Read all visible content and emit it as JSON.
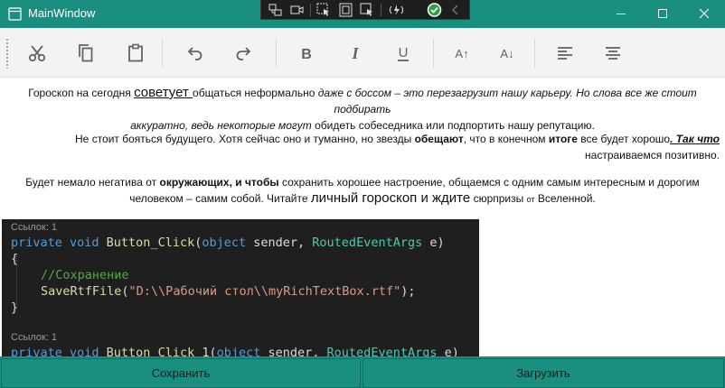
{
  "window": {
    "title": "MainWindow",
    "accent": "#1a8f7f",
    "controls": [
      "minimize-icon",
      "maximize-icon",
      "close-icon"
    ]
  },
  "devtools": {
    "icons": [
      "live-visual-tree-icon",
      "camera-icon",
      "select-element-icon",
      "display-layout-adorners-icon",
      "track-focus-icon",
      "hot-reload-icon",
      "check-icon",
      "collapse-chevron-icon"
    ]
  },
  "toolbar": {
    "icons": [
      "cut-icon",
      "copy-icon",
      "paste-icon",
      "undo-icon",
      "redo-icon",
      "bold-icon",
      "italic-icon",
      "underline-icon",
      "increase-font-icon",
      "decrease-font-icon",
      "align-left-icon",
      "align-center-icon"
    ],
    "bold_glyph": "B",
    "italic_glyph": "I",
    "underline_glyph": "U",
    "inc_glyph": "A↑",
    "dec_glyph": "A↓"
  },
  "document": {
    "p1": {
      "a": "Гороскоп на сегодня ",
      "b": "советует ",
      "c": "общаться неформально ",
      "d": "даже с боссом – это перезагрузит нашу карьеру. Но слова все же стоит подбирать",
      "e": "аккуратно, ведь некоторые могут ",
      "f": "обидеть собеседника или подпортить нашу репутацию."
    },
    "p2": {
      "a": "Не стоит бояться будущего. Хотя сейчас оно и туманно, но звезды ",
      "b": "обещают",
      "c": ", что в конечном ",
      "d": "итоге",
      "e": " все будет хорошо",
      "f": ". Так что",
      "g": "настраиваемся позитивно."
    },
    "p3": {
      "a": "Будет немало негатива от ",
      "b": "окружающих, и чтобы",
      "c": " сохранить хорошее настроение, общаемся с одним самым интересным и дорогим",
      "d": "человеком – самим собой. Читайте ",
      "e": "личный гороскоп и ждите",
      "f": " сюрпризы ",
      "g": "от",
      "h": " Вселенной."
    },
    "code": {
      "ref1": "Ссылок: 1",
      "sig1": {
        "kw": "private void ",
        "name": "Button_Click",
        "p1": "(",
        "kw2": "object",
        "p2": " sender, ",
        "type": "RoutedEventArgs",
        "p3": " e)"
      },
      "open": "{",
      "comment": "//Сохранение",
      "call": {
        "name": "SaveRtfFile",
        "p1": "(",
        "str": "\"D:\\\\Рабочий стол\\\\myRichTextBox.rtf\"",
        "p2": ");"
      },
      "close": "}",
      "ref2": "Ссылок: 1",
      "sig2": {
        "kw": "private void ",
        "name": "Button_Click_1",
        "p1": "(",
        "kw2": "object",
        "p2": " sender, ",
        "type": "RoutedEventArgs",
        "p3": " e)"
      }
    }
  },
  "buttons": {
    "save": "Сохранить",
    "load": "Загрузить"
  }
}
